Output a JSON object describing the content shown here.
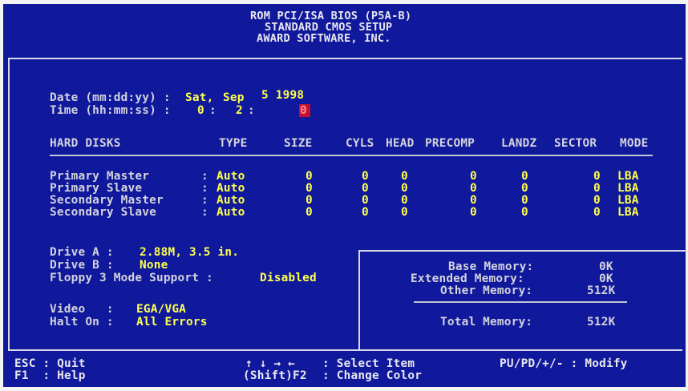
{
  "header": {
    "line1": "ROM PCI/ISA BIOS (P5A-B)",
    "line2": "STANDARD CMOS SETUP",
    "line3": "AWARD SOFTWARE, INC."
  },
  "datetime": {
    "date_label": "Date (mm:dd:yy) :",
    "date_weekday": "Sat,",
    "date_month": "Sep",
    "date_day_year": "5 1998",
    "time_label": "Time (hh:mm:ss) :",
    "time_hh": "0",
    "time_mm": "2",
    "time_ss": "0"
  },
  "disks": {
    "header": {
      "name": "HARD DISKS",
      "type": "TYPE",
      "size": "SIZE",
      "cyls": "CYLS",
      "head": "HEAD",
      "precomp": "PRECOMP",
      "landz": "LANDZ",
      "sector": "SECTOR",
      "mode": "MODE"
    },
    "rows": [
      {
        "name": "Primary Master",
        "type": "Auto",
        "size": "0",
        "cyls": "0",
        "head": "0",
        "precomp": "0",
        "landz": "0",
        "sector": "0",
        "mode": "LBA"
      },
      {
        "name": "Primary Slave",
        "type": "Auto",
        "size": "0",
        "cyls": "0",
        "head": "0",
        "precomp": "0",
        "landz": "0",
        "sector": "0",
        "mode": "LBA"
      },
      {
        "name": "Secondary Master",
        "type": "Auto",
        "size": "0",
        "cyls": "0",
        "head": "0",
        "precomp": "0",
        "landz": "0",
        "sector": "0",
        "mode": "LBA"
      },
      {
        "name": "Secondary Slave",
        "type": "Auto",
        "size": "0",
        "cyls": "0",
        "head": "0",
        "precomp": "0",
        "landz": "0",
        "sector": "0",
        "mode": "LBA"
      }
    ]
  },
  "drives": {
    "drive_a_label": "Drive A :",
    "drive_a_value": "2.88M, 3.5 in.",
    "drive_b_label": "Drive B :",
    "drive_b_value": "None",
    "floppy3_label": "Floppy 3 Mode Support :",
    "floppy3_value": "Disabled",
    "video_label": "Video   :",
    "video_value": "EGA/VGA",
    "halt_label": "Halt On :",
    "halt_value": "All Errors"
  },
  "memory": {
    "base_label": "Base Memory:",
    "base_value": "0K",
    "extended_label": "Extended Memory:",
    "extended_value": "0K",
    "other_label": "Other Memory:",
    "other_value": "512K",
    "total_label": "Total Memory:",
    "total_value": "512K"
  },
  "footer": {
    "esc_key": "ESC : Quit",
    "f1_key": "F1  : Help",
    "arrows": "↑ ↓ → ←",
    "select_item": ": Select Item",
    "shift_f2": "(Shift)F2",
    "change_color": ": Change Color",
    "modify": "PU/PD/+/- : Modify"
  },
  "colors": {
    "background": "#10189c",
    "text": "#d4d4dc",
    "value": "#ffff4c",
    "cursor": "#c8102e"
  }
}
